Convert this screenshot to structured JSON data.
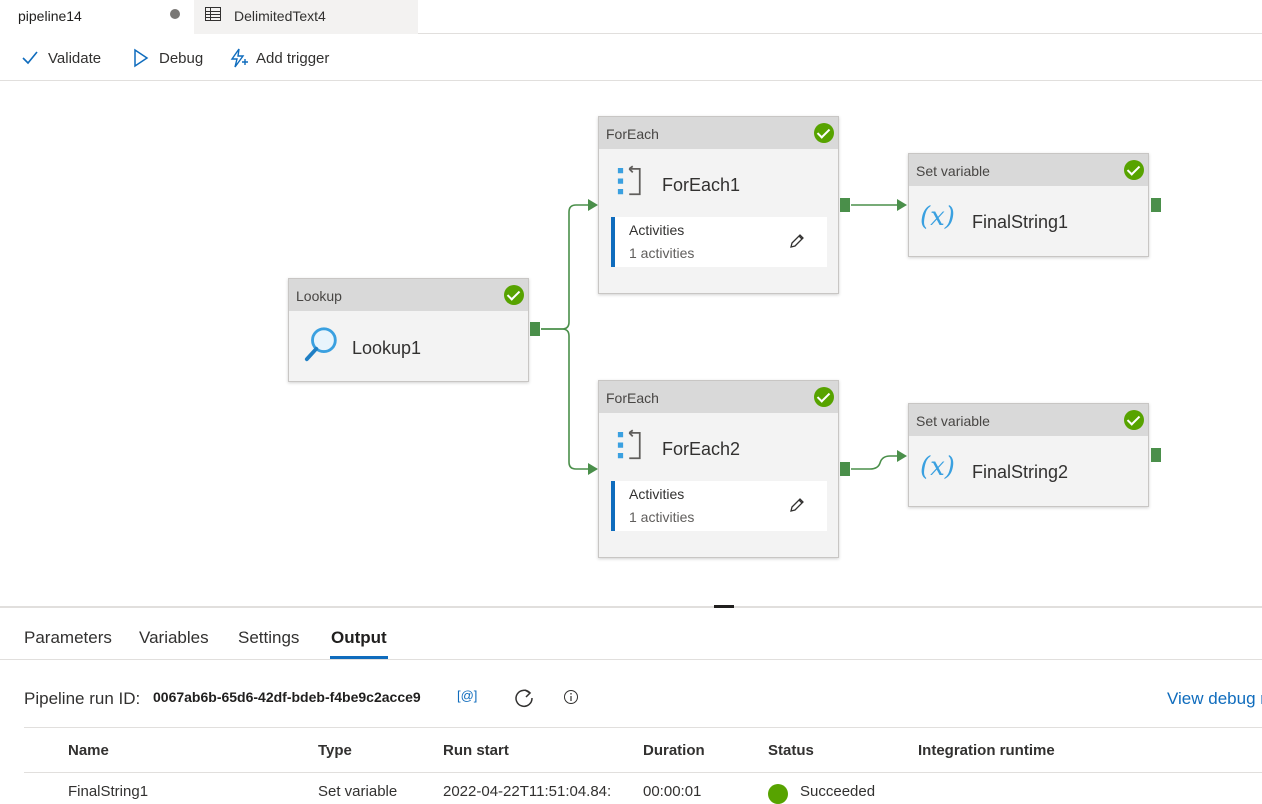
{
  "tabs": [
    {
      "label": "pipeline14",
      "lead": ")"
    },
    {
      "label": "DelimitedText4"
    }
  ],
  "toolbar": {
    "validate_label": "Validate",
    "debug_label": "Debug",
    "add_trigger_label": "Add trigger"
  },
  "activities": {
    "lookup": {
      "type": "Lookup",
      "name": "Lookup1"
    },
    "foreach1": {
      "type": "ForEach",
      "name": "ForEach1",
      "inner_title": "Activities",
      "inner_count": "1 activities"
    },
    "foreach2": {
      "type": "ForEach",
      "name": "ForEach2",
      "inner_title": "Activities",
      "inner_count": "1 activities"
    },
    "setvar1": {
      "type": "Set variable",
      "name": "FinalString1",
      "icon_text": "(x)"
    },
    "setvar2": {
      "type": "Set variable",
      "name": "FinalString2",
      "icon_text": "(x)"
    }
  },
  "panel": {
    "tabs": [
      "Parameters",
      "Variables",
      "Settings",
      "Output"
    ],
    "active_tab": "Output",
    "run_id_label": "Pipeline run ID:",
    "run_id_value": "0067ab6b-65d6-42df-bdeb-f4be9c2acce9",
    "copy_icon_text": "[@]",
    "view_debug_label": "View debug r",
    "columns": [
      "Name",
      "Type",
      "Run start",
      "Duration",
      "Status",
      "Integration runtime"
    ],
    "rows": [
      {
        "name": "FinalString1",
        "type": "Set variable",
        "run_start": "2022-04-22T11:51:04.84:",
        "duration": "00:00:01",
        "status": "Succeeded"
      }
    ]
  },
  "colors": {
    "accent": "#0f6cbd",
    "success": "#57a300",
    "connector": "#4a8f4a"
  }
}
